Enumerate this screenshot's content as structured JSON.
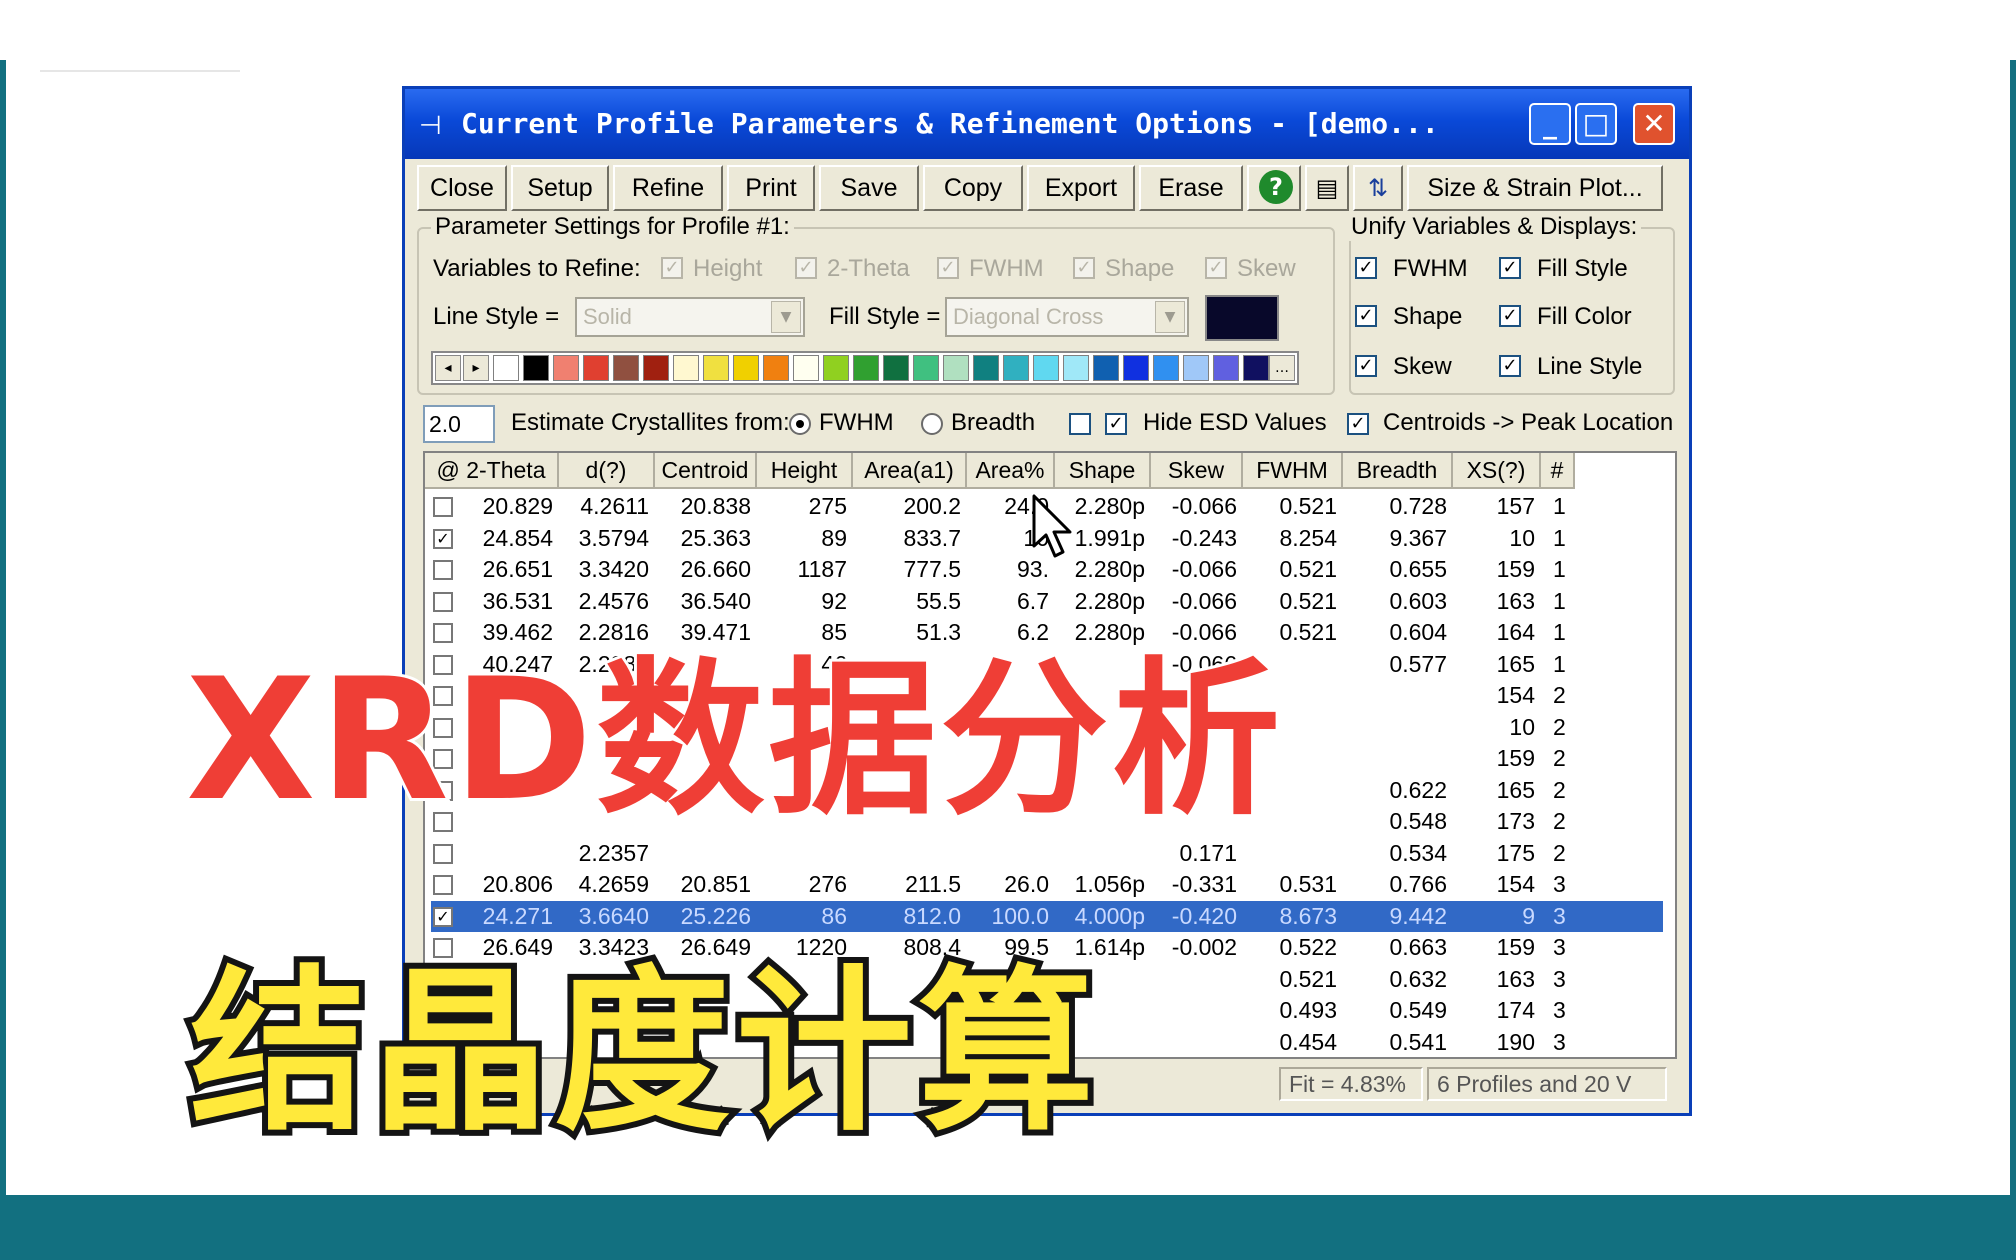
{
  "window": {
    "title": "Current Profile Parameters & Refinement Options - [demo...",
    "controls": {
      "minimize": "_",
      "maximize": "□",
      "close": "✕"
    }
  },
  "toolbar": {
    "close": "Close",
    "setup": "Setup",
    "refine": "Refine",
    "print": "Print",
    "save": "Save",
    "copy": "Copy",
    "export": "Export",
    "erase": "Erase",
    "help_icon": "?",
    "size_strain": "Size & Strain Plot..."
  },
  "param_settings": {
    "group_label": "Parameter Settings for Profile #1:",
    "variables_label": "Variables to Refine:",
    "variables": [
      {
        "label": "Height",
        "checked": true
      },
      {
        "label": "2-Theta",
        "checked": true
      },
      {
        "label": "FWHM",
        "checked": true
      },
      {
        "label": "Shape",
        "checked": true
      },
      {
        "label": "Skew",
        "checked": true
      }
    ],
    "line_style_label": "Line Style =",
    "line_style_value": "Solid",
    "fill_style_label": "Fill Style =",
    "fill_style_value": "Diagonal Cross",
    "selected_color": "#08082a",
    "palette": [
      "#ffffff",
      "#000000",
      "#f08070",
      "#e04030",
      "#905040",
      "#a02010",
      "#fff8d0",
      "#f0e040",
      "#f0d000",
      "#f08010",
      "#fffff0",
      "#90d020",
      "#30a030",
      "#107040",
      "#40c080",
      "#b0e0c0",
      "#108080",
      "#30b0c0",
      "#60d8f0",
      "#a0e8f8",
      "#1060b0",
      "#1030e0",
      "#3090f0",
      "#a0c8f8",
      "#6060e0",
      "#101060"
    ]
  },
  "unify": {
    "group_label": "Unify Variables & Displays:",
    "options": [
      {
        "label": "FWHM",
        "checked": true
      },
      {
        "label": "Fill Style",
        "checked": true
      },
      {
        "label": "Shape",
        "checked": true
      },
      {
        "label": "Fill Color",
        "checked": true
      },
      {
        "label": "Skew",
        "checked": true
      },
      {
        "label": "Line Style",
        "checked": true
      }
    ]
  },
  "options_row": {
    "value": "2.0",
    "estimate_label": "Estimate Crystallites from:",
    "fwhm_label": "FWHM",
    "breadth_label": "Breadth",
    "hide_esd_label": "Hide ESD Values",
    "centroids_label": "Centroids -> Peak Location"
  },
  "table": {
    "columns": [
      "@ 2-Theta",
      "d(?)",
      "Centroid",
      "Height",
      "Area(a1)",
      "Area%",
      "Shape",
      "Skew",
      "FWHM",
      "Breadth",
      "XS(?)",
      "#"
    ],
    "rows": [
      {
        "checked": false,
        "selected": false,
        "cells": [
          "20.829",
          "4.2611",
          "20.838",
          "275",
          "200.2",
          "24.0",
          "2.280p",
          "-0.066",
          "0.521",
          "0.728",
          "157",
          "1"
        ]
      },
      {
        "checked": true,
        "selected": false,
        "cells": [
          "24.854",
          "3.5794",
          "25.363",
          "89",
          "833.7",
          "10",
          "1.991p",
          "-0.243",
          "8.254",
          "9.367",
          "10",
          "1"
        ]
      },
      {
        "checked": false,
        "selected": false,
        "cells": [
          "26.651",
          "3.3420",
          "26.660",
          "1187",
          "777.5",
          "93.",
          "2.280p",
          "-0.066",
          "0.521",
          "0.655",
          "159",
          "1"
        ]
      },
      {
        "checked": false,
        "selected": false,
        "cells": [
          "36.531",
          "2.4576",
          "36.540",
          "92",
          "55.5",
          "6.7",
          "2.280p",
          "-0.066",
          "0.521",
          "0.603",
          "163",
          "1"
        ]
      },
      {
        "checked": false,
        "selected": false,
        "cells": [
          "39.462",
          "2.2816",
          "39.471",
          "85",
          "51.3",
          "6.2",
          "2.280p",
          "-0.066",
          "0.521",
          "0.604",
          "164",
          "1"
        ]
      },
      {
        "checked": false,
        "selected": false,
        "cells": [
          "40.247",
          "2.2389",
          "",
          "46",
          "",
          "",
          "",
          "-0.066",
          "",
          "0.577",
          "165",
          "1"
        ]
      },
      {
        "checked": false,
        "selected": false,
        "cells": [
          "",
          "",
          "",
          "",
          "",
          "",
          "",
          "",
          "",
          "",
          "154",
          "2"
        ]
      },
      {
        "checked": false,
        "selected": false,
        "cells": [
          "",
          "",
          "",
          "",
          "",
          "",
          "",
          "",
          "",
          "",
          "10",
          "2"
        ]
      },
      {
        "checked": false,
        "selected": false,
        "cells": [
          "",
          "",
          "",
          "",
          "",
          "",
          "",
          "",
          "",
          "",
          "159",
          "2"
        ]
      },
      {
        "checked": false,
        "selected": false,
        "cells": [
          "",
          "",
          "",
          "",
          "",
          "",
          "",
          "",
          "",
          "0.622",
          "165",
          "2"
        ]
      },
      {
        "checked": false,
        "selected": false,
        "cells": [
          "",
          "",
          "",
          "",
          "",
          "",
          "",
          "",
          "",
          "0.548",
          "173",
          "2"
        ]
      },
      {
        "checked": false,
        "selected": false,
        "cells": [
          "",
          "2.2357",
          "",
          "",
          "",
          "",
          "",
          "0.171",
          "",
          "0.534",
          "175",
          "2"
        ]
      },
      {
        "checked": false,
        "selected": false,
        "cells": [
          "20.806",
          "4.2659",
          "20.851",
          "276",
          "211.5",
          "26.0",
          "1.056p",
          "-0.331",
          "0.531",
          "0.766",
          "154",
          "3"
        ]
      },
      {
        "checked": true,
        "selected": true,
        "cells": [
          "24.271",
          "3.6640",
          "25.226",
          "86",
          "812.0",
          "100.0",
          "4.000p",
          "-0.420",
          "8.673",
          "9.442",
          "9",
          "3"
        ]
      },
      {
        "checked": false,
        "selected": false,
        "cells": [
          "26.649",
          "3.3423",
          "26.649",
          "1220",
          "808.4",
          "99.5",
          "1.614p",
          "-0.002",
          "0.522",
          "0.663",
          "159",
          "3"
        ]
      },
      {
        "checked": false,
        "selected": false,
        "cells": [
          "",
          "",
          "",
          "",
          "",
          "",
          "",
          "",
          "0.521",
          "0.632",
          "163",
          "3"
        ]
      },
      {
        "checked": false,
        "selected": false,
        "cells": [
          "",
          "",
          "",
          "",
          "",
          "",
          "",
          "",
          "0.493",
          "0.549",
          "174",
          "3"
        ]
      },
      {
        "checked": false,
        "selected": false,
        "cells": [
          "",
          "",
          "",
          "",
          "",
          "",
          "",
          "",
          "0.454",
          "0.541",
          "190",
          "3"
        ]
      }
    ]
  },
  "status": {
    "fit": "Fit = 4.83%",
    "profiles": "6 Profiles and 20 V"
  },
  "overlay": {
    "headline": "XRD数据分析",
    "subheadline": "结晶度计算",
    "headline_color": "#ef3e36",
    "subheadline_color": "#ffe93b"
  }
}
